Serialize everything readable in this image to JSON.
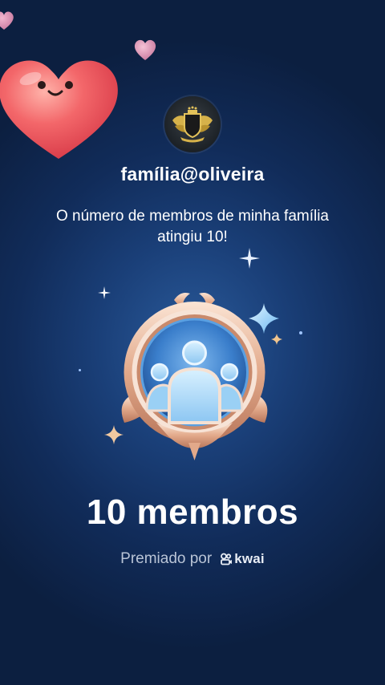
{
  "profile": {
    "username": "família@oliveira",
    "avatar_icon": "winged-shield-icon"
  },
  "achievement": {
    "message": "O número de membros de minha família atingiu 10!",
    "badge_icon": "family-members-badge-icon",
    "count_label": "10 membros"
  },
  "award": {
    "label": "Premiado por",
    "brand": "kwai",
    "brand_icon": "kwai-logo-icon"
  },
  "colors": {
    "background_top": "#0c1f40",
    "background_center": "#2a5a9a",
    "heart": "#ef5a5e",
    "badge_rim": "#e8b596",
    "badge_inner": "#3a7ecb",
    "text_primary": "#ffffff",
    "text_secondary": "#b9c4d6"
  }
}
